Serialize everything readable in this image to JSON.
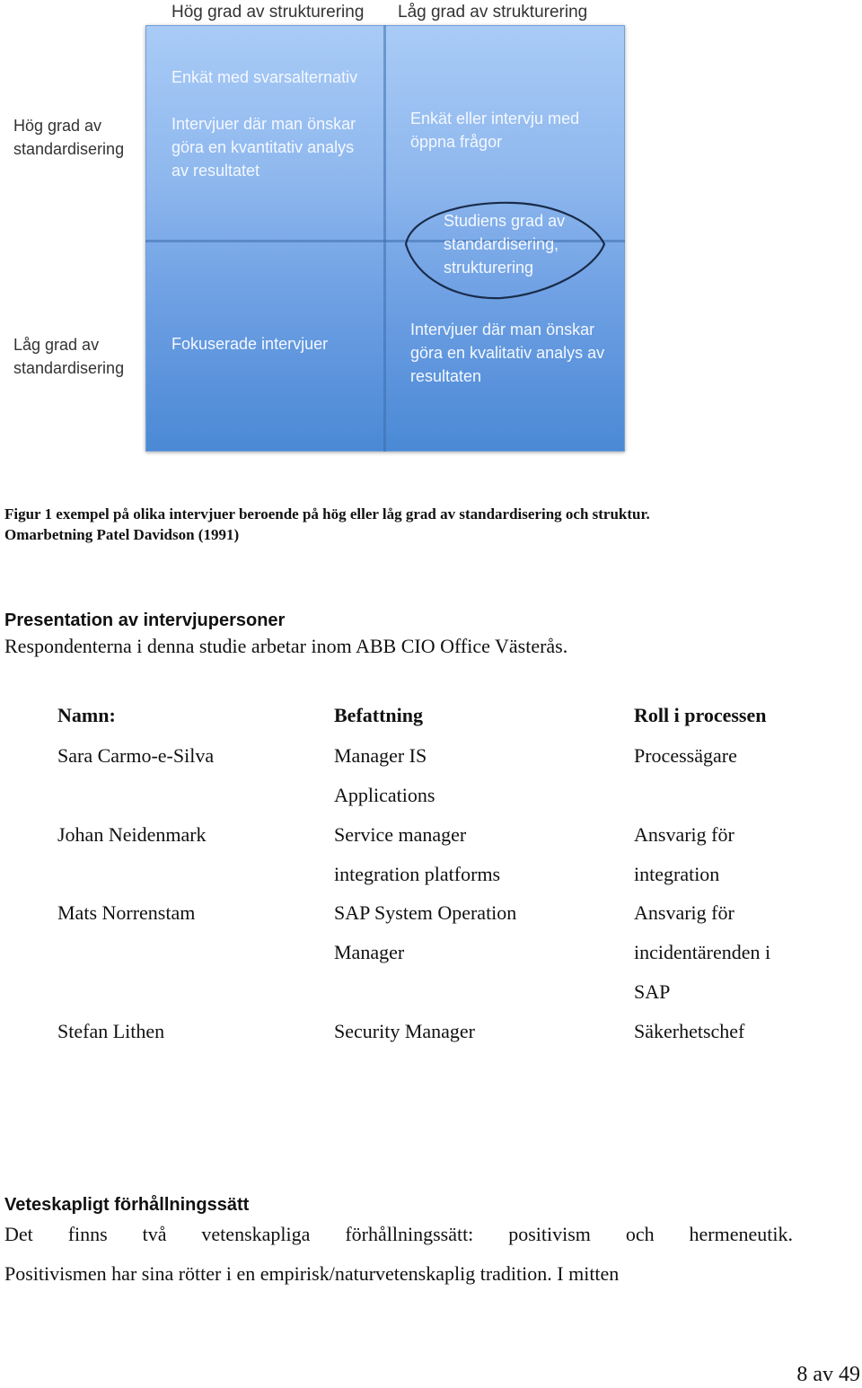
{
  "figure": {
    "column_labels": [
      "Hög grad av strukturering",
      "Låg grad av strukturering"
    ],
    "row_labels": [
      [
        "Hög grad av",
        "standardisering"
      ],
      [
        "Låg grad av",
        "standardisering"
      ]
    ],
    "cells": {
      "top_left": {
        "item1": "Enkät med svarsalternativ",
        "item2": [
          "Intervjuer där man önskar",
          "göra en kvantitativ analys",
          "av resultatet"
        ]
      },
      "top_right": [
        "Enkät eller intervju med",
        "öppna frågor"
      ],
      "bottom_left": [
        "Fokuserade intervjuer"
      ],
      "bottom_right": [
        "Intervjuer där man önskar",
        "göra en kvalitativ analys av",
        "resultaten"
      ]
    },
    "highlight": [
      "Studiens grad av",
      "standardisering,",
      "strukturering"
    ],
    "colors": {
      "grid_top": "#a9cbf6",
      "grid_bottom": "#4b89d5",
      "cell_text": "#f4f8ff",
      "ellipse_stroke": "#1a2c4a"
    }
  },
  "caption": {
    "line1": "Figur 1 exempel på olika intervjuer beroende på hög eller låg grad av standardisering och struktur.",
    "line2": "Omarbetning Patel Davidson (1991)"
  },
  "presentation": {
    "heading": "Presentation av intervjupersoner",
    "text": "Respondenterna i denna studie arbetar inom ABB CIO Office Västerås."
  },
  "table": {
    "headers": [
      "Namn:",
      "Befattning",
      "Roll i processen"
    ],
    "rows": [
      {
        "name": "Sara Carmo-e-Silva",
        "title": [
          "Manager IS",
          "Applications"
        ],
        "role": [
          "Processägare"
        ]
      },
      {
        "name": "Johan Neidenmark",
        "title": [
          "Service manager",
          "integration platforms"
        ],
        "role": [
          "Ansvarig för",
          "integration"
        ]
      },
      {
        "name": "Mats Norrenstam",
        "title": [
          "SAP System Operation",
          "Manager"
        ],
        "role": [
          "Ansvarig för",
          "incidentärenden i",
          "SAP"
        ]
      },
      {
        "name": "Stefan Lithen",
        "title": [
          "Security Manager"
        ],
        "role": [
          "Säkerhetschef"
        ]
      }
    ]
  },
  "scientific": {
    "heading": "Veteskapligt förhållningssätt",
    "line1_words": [
      "Det",
      "finns",
      "två",
      "vetenskapliga",
      "förhållningssätt:",
      "positivism",
      "och",
      "hermeneutik."
    ],
    "line2": "Positivismen har sina rötter i en empirisk/naturvetenskaplig tradition. I mitten"
  },
  "footer": {
    "page": "8 av 49"
  }
}
